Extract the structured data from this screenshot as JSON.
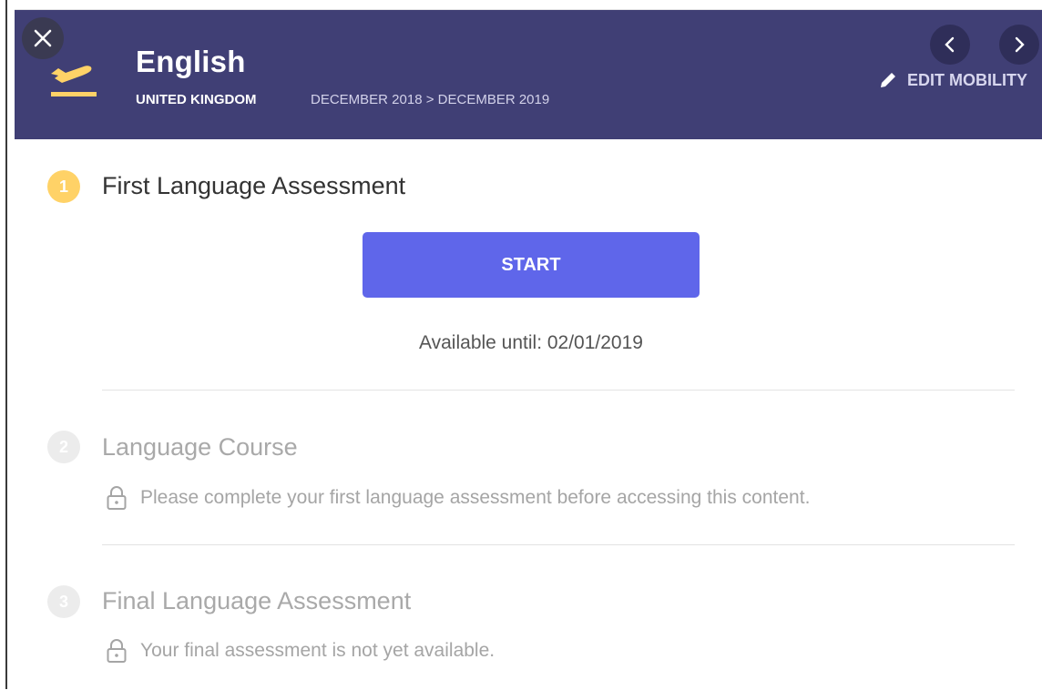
{
  "header": {
    "title": "English",
    "country": "UNITED KINGDOM",
    "dates": "DECEMBER 2018 > DECEMBER 2019",
    "edit_label": "EDIT MOBILITY",
    "bg_color": "#403f75"
  },
  "steps": [
    {
      "number": "1",
      "title": "First Language Assessment",
      "status": "active",
      "button_label": "START",
      "availability": "Available until: 02/01/2019"
    },
    {
      "number": "2",
      "title": "Language Course",
      "status": "locked",
      "lock_message": "Please complete your first language assessment before accessing this content."
    },
    {
      "number": "3",
      "title": "Final Language Assessment",
      "status": "locked",
      "lock_message": "Your final assessment is not yet available."
    }
  ],
  "colors": {
    "accent": "#5f66ea",
    "active_step": "#ffd267",
    "locked_text": "#a9a9a9"
  },
  "icons": {
    "close": "close-icon",
    "departure": "plane-departure-icon",
    "edit": "pencil-icon",
    "prev": "chevron-left-icon",
    "next": "chevron-right-icon",
    "lock": "lock-icon"
  }
}
